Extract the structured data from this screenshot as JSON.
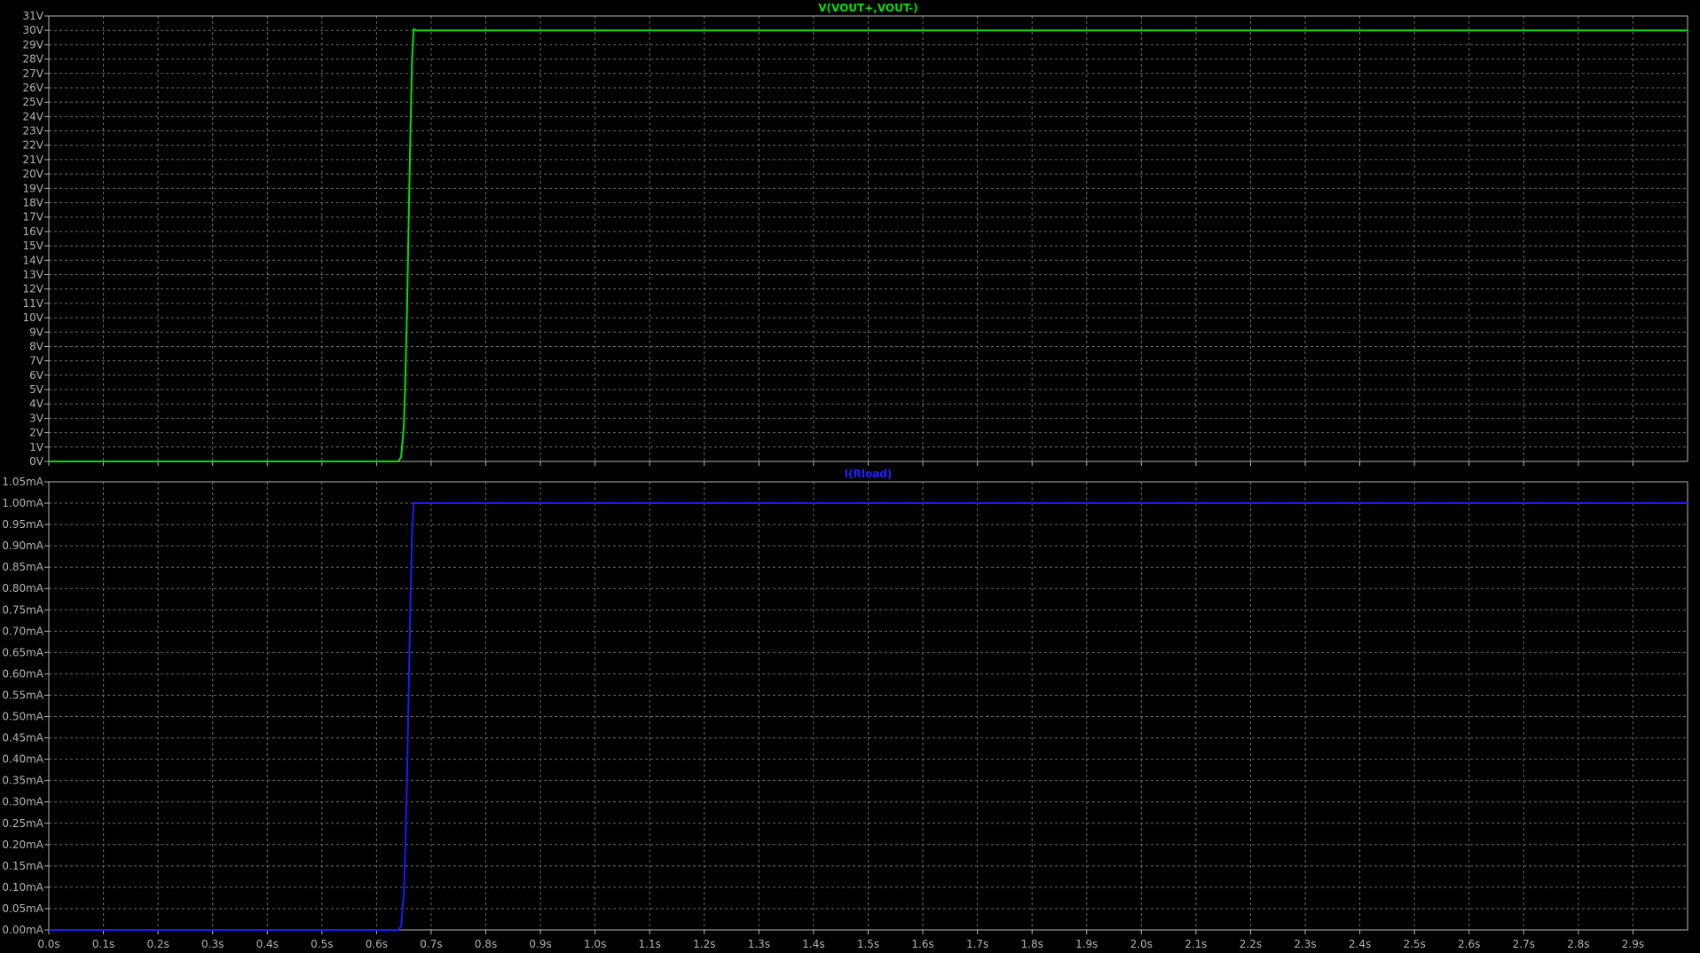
{
  "chart_data": [
    {
      "type": "line",
      "title": "V(VOUT+,VOUT-)",
      "title_color": "#00e000",
      "line_color": "#00e000",
      "xlim": [
        0,
        3.0
      ],
      "ylim": [
        0,
        31
      ],
      "x_ticks": [
        "0.0s",
        "0.1s",
        "0.2s",
        "0.3s",
        "0.4s",
        "0.5s",
        "0.6s",
        "0.7s",
        "0.8s",
        "0.9s",
        "1.0s",
        "1.1s",
        "1.2s",
        "1.3s",
        "1.4s",
        "1.5s",
        "1.6s",
        "1.7s",
        "1.8s",
        "1.9s",
        "2.0s",
        "2.1s",
        "2.2s",
        "2.3s",
        "2.4s",
        "2.5s",
        "2.6s",
        "2.7s",
        "2.8s",
        "2.9s"
      ],
      "y_ticks": [
        "0V",
        "1V",
        "2V",
        "3V",
        "4V",
        "5V",
        "6V",
        "7V",
        "8V",
        "9V",
        "10V",
        "11V",
        "12V",
        "13V",
        "14V",
        "15V",
        "16V",
        "17V",
        "18V",
        "19V",
        "20V",
        "21V",
        "22V",
        "23V",
        "24V",
        "25V",
        "26V",
        "27V",
        "28V",
        "29V",
        "30V",
        "31V"
      ],
      "grid": true,
      "x": [
        0,
        0.64,
        0.645,
        0.65,
        0.653,
        0.656,
        0.659,
        0.662,
        0.665,
        0.668,
        0.672,
        3.0
      ],
      "y": [
        0,
        0,
        0.3,
        2.5,
        6,
        11,
        17,
        23,
        28,
        30.1,
        30.0,
        30.0
      ]
    },
    {
      "type": "line",
      "title": "I(Rload)",
      "title_color": "#2020ff",
      "line_color": "#1a1aff",
      "xlim": [
        0,
        3.0
      ],
      "ylim": [
        0,
        1.05
      ],
      "x_ticks": [
        "0.0s",
        "0.1s",
        "0.2s",
        "0.3s",
        "0.4s",
        "0.5s",
        "0.6s",
        "0.7s",
        "0.8s",
        "0.9s",
        "1.0s",
        "1.1s",
        "1.2s",
        "1.3s",
        "1.4s",
        "1.5s",
        "1.6s",
        "1.7s",
        "1.8s",
        "1.9s",
        "2.0s",
        "2.1s",
        "2.2s",
        "2.3s",
        "2.4s",
        "2.5s",
        "2.6s",
        "2.7s",
        "2.8s",
        "2.9s"
      ],
      "y_ticks": [
        "0.00mA",
        "0.05mA",
        "0.10mA",
        "0.15mA",
        "0.20mA",
        "0.25mA",
        "0.30mA",
        "0.35mA",
        "0.40mA",
        "0.45mA",
        "0.50mA",
        "0.55mA",
        "0.60mA",
        "0.65mA",
        "0.70mA",
        "0.75mA",
        "0.80mA",
        "0.85mA",
        "0.90mA",
        "0.95mA",
        "1.00mA",
        "1.05mA"
      ],
      "grid": true,
      "x": [
        0,
        0.64,
        0.645,
        0.65,
        0.653,
        0.656,
        0.659,
        0.662,
        0.665,
        0.668,
        0.672,
        3.0
      ],
      "y": [
        0,
        0,
        0.01,
        0.085,
        0.2,
        0.37,
        0.57,
        0.77,
        0.93,
        1.0,
        1.0,
        1.0
      ]
    }
  ]
}
